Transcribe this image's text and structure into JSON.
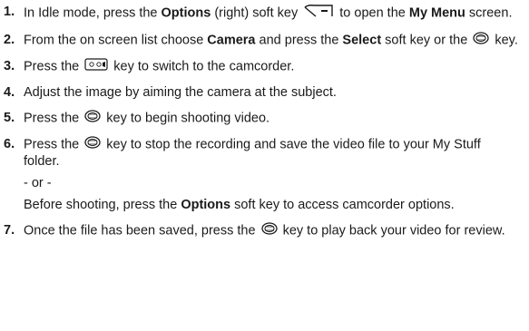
{
  "steps": [
    {
      "num": "1.",
      "t1": "In Idle mode, press the ",
      "b1": "Options",
      "t2": " (right) soft key ",
      "t3": " to open the ",
      "b2": "My Menu",
      "t4": " screen."
    },
    {
      "num": "2.",
      "t1": "From the on screen list choose ",
      "b1": "Camera",
      "t2": " and press the ",
      "b2": "Select",
      "t3": " soft key or the ",
      "t4": " key."
    },
    {
      "num": "3.",
      "t1": "Press the ",
      "t2": " key to switch to the camcorder."
    },
    {
      "num": "4.",
      "t1": "Adjust the image by aiming the camera at the subject."
    },
    {
      "num": "5.",
      "t1": "Press the ",
      "t2": " key to begin shooting video."
    },
    {
      "num": "6.",
      "t1": "Press the ",
      "t2": " key to stop the recording and save the video file to your My Stuff folder.",
      "or": "- or -",
      "t3": "Before shooting, press the ",
      "b1": "Options",
      "t4": " soft key to access camcorder options."
    },
    {
      "num": "7.",
      "t1": "Once the file has been saved, press the ",
      "t2": " key to play back your video for review."
    }
  ],
  "icons": {
    "options_softkey": "right-soft-key-icon",
    "ok_key": "center-ok-key-icon",
    "camera_key": "camcorder-key-icon"
  }
}
